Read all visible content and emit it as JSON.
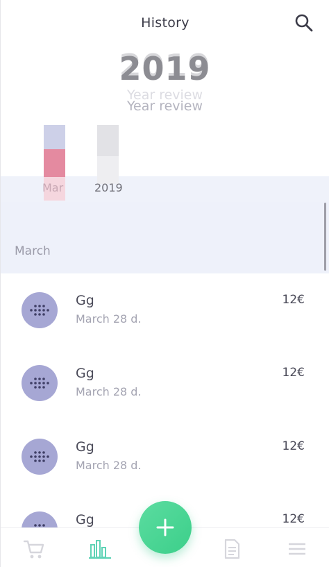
{
  "header": {
    "title": "History",
    "search_icon": "search-icon"
  },
  "year": {
    "value": "2019",
    "subtitle": "Year review"
  },
  "chart": {
    "bars": [
      {
        "label": "Mar",
        "segments": [
          {
            "color": "#cdd0e8"
          },
          {
            "color": "#e48aa0"
          },
          {
            "color": "#f5d6de"
          }
        ]
      },
      {
        "label": "2019",
        "segments": [
          {
            "color": "#e2e2e6"
          },
          {
            "color": "#eeeef1"
          }
        ]
      }
    ]
  },
  "section": {
    "label": "March"
  },
  "transactions": [
    {
      "title": "Gg",
      "date": "March 28 d.",
      "amount": "12€",
      "icon": "dots-grid-icon"
    },
    {
      "title": "Gg",
      "date": "March 28 d.",
      "amount": "12€",
      "icon": "dots-grid-icon"
    },
    {
      "title": "Gg",
      "date": "March 28 d.",
      "amount": "12€",
      "icon": "dots-grid-icon"
    },
    {
      "title": "Gg",
      "date": "",
      "amount": "12€",
      "icon": "dots-grid-icon"
    }
  ],
  "bottom_nav": {
    "items": [
      {
        "icon": "cart-icon",
        "active": false
      },
      {
        "icon": "bar-chart-icon",
        "active": true
      },
      {
        "icon": "document-icon",
        "active": false
      },
      {
        "icon": "menu-icon",
        "active": false
      }
    ],
    "fab": {
      "label": "+"
    }
  },
  "colors": {
    "accent": "#3ccf8a",
    "active_nav": "#5fd3b6",
    "avatar": "#a6a7d4",
    "section_bg": "#eef1fa"
  }
}
